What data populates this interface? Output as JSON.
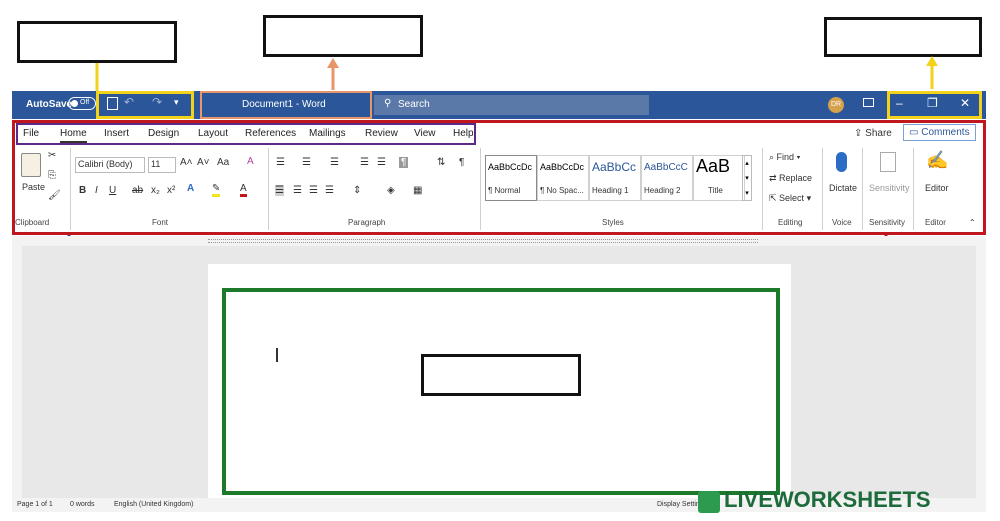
{
  "title_bar": {
    "autosave_label": "AutoSave",
    "autosave_state": "Off",
    "document_title": "Document1 - Word",
    "search_placeholder": "Search",
    "user_initials": "DR",
    "window_controls": [
      "–",
      "❐",
      "✕"
    ]
  },
  "ribbon_tabs": [
    "File",
    "Home",
    "Insert",
    "Design",
    "Layout",
    "References",
    "Mailings",
    "Review",
    "View",
    "Help"
  ],
  "ribbon_right": {
    "share": "Share",
    "comments": "Comments"
  },
  "clipboard": {
    "paste": "Paste",
    "group": "Clipboard"
  },
  "font": {
    "name": "Calibri (Body)",
    "size": "11",
    "grow": "A˄",
    "shrink": "A˅",
    "case": "Aa",
    "bold": "B",
    "italic": "I",
    "underline": "U",
    "strike": "ab",
    "subscript": "x₂",
    "superscript": "x²",
    "group": "Font"
  },
  "paragraph": {
    "group": "Paragraph"
  },
  "styles": {
    "items": [
      {
        "preview": "AaBbCcDc",
        "name": "¶ Normal"
      },
      {
        "preview": "AaBbCcDc",
        "name": "¶ No Spac..."
      },
      {
        "preview": "AaBbCc",
        "name": "Heading 1"
      },
      {
        "preview": "AaBbCcC",
        "name": "Heading 2"
      },
      {
        "preview": "AaB",
        "name": "Title"
      }
    ],
    "group": "Styles"
  },
  "editing": {
    "find": "Find",
    "replace": "Replace",
    "select": "Select",
    "group": "Editing"
  },
  "voice": {
    "dictate": "Dictate",
    "group": "Voice"
  },
  "sensitivity": {
    "label": "Sensitivity",
    "group": "Sensitivity"
  },
  "editor": {
    "label": "Editor",
    "group": "Editor"
  },
  "status_bar": {
    "page": "Page 1 of 1",
    "words": "0 words",
    "language": "English (United Kingdom)",
    "display_settings": "Display Settings"
  },
  "watermark": "LIVEWORKSHEETS",
  "colors": {
    "titlebar": "#2b579a",
    "ribbon_frame": "#c0171f",
    "body_frame": "#1c7a2a",
    "yellow_highlight": "#f2d21b",
    "orange_highlight": "#e8956a",
    "purple_arrow": "#5b2a86",
    "red_arrow": "#c0171f"
  }
}
